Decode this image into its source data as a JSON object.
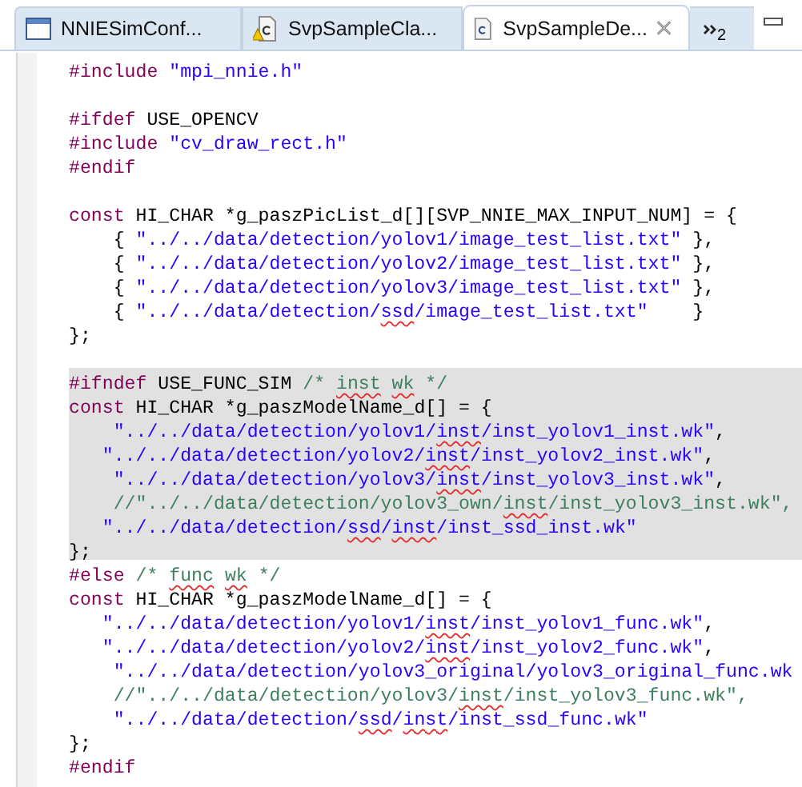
{
  "tabs": [
    {
      "label": "NNIESimConf...",
      "kind": "window",
      "selected": false
    },
    {
      "label": "SvpSampleCla...",
      "kind": "c_warning",
      "selected": false
    },
    {
      "label": "SvpSampleDe...",
      "kind": "c",
      "selected": true
    }
  ],
  "overflow": {
    "label": "2"
  },
  "lines": [
    {
      "kind": "code",
      "highlighted": false,
      "tokens": [
        {
          "t": "#include",
          "kind": "preproc",
          "misspelled": false
        },
        {
          "t": " \"mpi_nnie.h\"",
          "kind": "string",
          "misspelled": false
        }
      ]
    },
    {
      "kind": "blank",
      "highlighted": false
    },
    {
      "kind": "code",
      "highlighted": false,
      "tokens": [
        {
          "t": "#ifdef",
          "kind": "preproc",
          "misspelled": false
        },
        {
          "t": " USE_OPENCV",
          "kind": "plain",
          "misspelled": false
        }
      ]
    },
    {
      "kind": "code",
      "highlighted": false,
      "tokens": [
        {
          "t": "#include",
          "kind": "preproc",
          "misspelled": false
        },
        {
          "t": " \"cv_draw_rect.h\"",
          "kind": "string",
          "misspelled": false
        }
      ]
    },
    {
      "kind": "code",
      "highlighted": false,
      "tokens": [
        {
          "t": "#endif",
          "kind": "preproc",
          "misspelled": false
        }
      ]
    },
    {
      "kind": "blank",
      "highlighted": false
    },
    {
      "kind": "code",
      "highlighted": false,
      "tokens": [
        {
          "t": "const",
          "kind": "keyword",
          "misspelled": false
        },
        {
          "t": " HI_CHAR *g_paszPicList_d[][SVP_NNIE_MAX_INPUT_NUM] = {",
          "kind": "plain",
          "misspelled": false
        }
      ]
    },
    {
      "kind": "code",
      "highlighted": false,
      "tokens": [
        {
          "t": "    { ",
          "kind": "plain",
          "misspelled": false
        },
        {
          "t": "\"../../data/detection/yolov1/image_test_list.txt\"",
          "kind": "string",
          "misspelled": false
        },
        {
          "t": " },",
          "kind": "plain",
          "misspelled": false
        }
      ]
    },
    {
      "kind": "code",
      "highlighted": false,
      "tokens": [
        {
          "t": "    { ",
          "kind": "plain",
          "misspelled": false
        },
        {
          "t": "\"../../data/detection/yolov2/image_test_list.txt\"",
          "kind": "string",
          "misspelled": false
        },
        {
          "t": " },",
          "kind": "plain",
          "misspelled": false
        }
      ]
    },
    {
      "kind": "code",
      "highlighted": false,
      "tokens": [
        {
          "t": "    { ",
          "kind": "plain",
          "misspelled": false
        },
        {
          "t": "\"../../data/detection/yolov3/image_test_list.txt\"",
          "kind": "string",
          "misspelled": false
        },
        {
          "t": " },",
          "kind": "plain",
          "misspelled": false
        }
      ]
    },
    {
      "kind": "code",
      "highlighted": false,
      "tokens": [
        {
          "t": "    { ",
          "kind": "plain",
          "misspelled": false
        },
        {
          "t": "\"../../data/detection/",
          "kind": "string",
          "misspelled": false
        },
        {
          "t": "ssd",
          "kind": "string",
          "misspelled": true
        },
        {
          "t": "/image_test_list.txt\"",
          "kind": "string",
          "misspelled": false
        },
        {
          "t": "    }",
          "kind": "plain",
          "misspelled": false
        }
      ]
    },
    {
      "kind": "code",
      "highlighted": false,
      "tokens": [
        {
          "t": "};",
          "kind": "plain",
          "misspelled": false
        }
      ]
    },
    {
      "kind": "blank",
      "highlighted": false
    },
    {
      "kind": "code",
      "highlighted": true,
      "tokens": [
        {
          "t": "#ifndef",
          "kind": "preproc",
          "misspelled": false
        },
        {
          "t": " USE_FUNC_SIM ",
          "kind": "plain",
          "misspelled": false
        },
        {
          "t": "/* ",
          "kind": "comment",
          "misspelled": false
        },
        {
          "t": "inst",
          "kind": "comment",
          "misspelled": true
        },
        {
          "t": " wk",
          "kind": "comment",
          "misspelled": true
        },
        {
          "t": " */",
          "kind": "comment",
          "misspelled": false
        }
      ]
    },
    {
      "kind": "code",
      "highlighted": true,
      "tokens": [
        {
          "t": "const",
          "kind": "keyword",
          "misspelled": false
        },
        {
          "t": " HI_CHAR *g_paszModelName_d[] = {",
          "kind": "plain",
          "misspelled": false
        }
      ]
    },
    {
      "kind": "code",
      "highlighted": true,
      "tokens": [
        {
          "t": "    \"../../data/detection/yolov1/",
          "kind": "string",
          "misspelled": false
        },
        {
          "t": "inst",
          "kind": "string",
          "misspelled": true
        },
        {
          "t": "/inst_yolov1_inst.wk\"",
          "kind": "string",
          "misspelled": false
        },
        {
          "t": ",",
          "kind": "plain",
          "misspelled": false
        }
      ]
    },
    {
      "kind": "code",
      "highlighted": true,
      "tokens": [
        {
          "t": "   \"../../data/detection/yolov2/",
          "kind": "string",
          "misspelled": false
        },
        {
          "t": "inst",
          "kind": "string",
          "misspelled": true
        },
        {
          "t": "/inst_yolov2_inst.wk\"",
          "kind": "string",
          "misspelled": false
        },
        {
          "t": ",",
          "kind": "plain",
          "misspelled": false
        }
      ]
    },
    {
      "kind": "code",
      "highlighted": true,
      "tokens": [
        {
          "t": "    \"../../data/detection/yolov3/",
          "kind": "string",
          "misspelled": false
        },
        {
          "t": "inst",
          "kind": "string",
          "misspelled": true
        },
        {
          "t": "/inst_yolov3_inst.wk\"",
          "kind": "string",
          "misspelled": false
        },
        {
          "t": ",",
          "kind": "plain",
          "misspelled": false
        }
      ]
    },
    {
      "kind": "code",
      "highlighted": true,
      "tokens": [
        {
          "t": "    //\"../../data/detection/yolov3_own/",
          "kind": "comment",
          "misspelled": false
        },
        {
          "t": "inst",
          "kind": "comment",
          "misspelled": true
        },
        {
          "t": "/inst_yolov3_inst.wk\",",
          "kind": "comment",
          "misspelled": false
        }
      ]
    },
    {
      "kind": "code",
      "highlighted": true,
      "tokens": [
        {
          "t": "   \"../../data/detection/",
          "kind": "string",
          "misspelled": false
        },
        {
          "t": "ssd",
          "kind": "string",
          "misspelled": true
        },
        {
          "t": "/",
          "kind": "string",
          "misspelled": false
        },
        {
          "t": "inst",
          "kind": "string",
          "misspelled": true
        },
        {
          "t": "/inst_ssd_inst.wk\"",
          "kind": "string",
          "misspelled": false
        }
      ]
    },
    {
      "kind": "code",
      "highlighted": true,
      "tokens": [
        {
          "t": "};",
          "kind": "plain",
          "misspelled": false
        }
      ]
    },
    {
      "kind": "code",
      "highlighted": false,
      "tokens": [
        {
          "t": "#else",
          "kind": "preproc",
          "misspelled": false
        },
        {
          "t": " /* ",
          "kind": "comment",
          "misspelled": false
        },
        {
          "t": "func",
          "kind": "comment",
          "misspelled": true
        },
        {
          "t": " wk",
          "kind": "comment",
          "misspelled": true
        },
        {
          "t": " */",
          "kind": "comment",
          "misspelled": false
        }
      ]
    },
    {
      "kind": "code",
      "highlighted": false,
      "tokens": [
        {
          "t": "const",
          "kind": "keyword",
          "misspelled": false
        },
        {
          "t": " HI_CHAR *g_paszModelName_d[] = {",
          "kind": "plain",
          "misspelled": false
        }
      ]
    },
    {
      "kind": "code",
      "highlighted": false,
      "tokens": [
        {
          "t": "   \"../../data/detection/yolov1/",
          "kind": "string",
          "misspelled": false
        },
        {
          "t": "inst",
          "kind": "string",
          "misspelled": true
        },
        {
          "t": "/inst_yolov1_func.wk\"",
          "kind": "string",
          "misspelled": false
        },
        {
          "t": ",",
          "kind": "plain",
          "misspelled": false
        }
      ]
    },
    {
      "kind": "code",
      "highlighted": false,
      "tokens": [
        {
          "t": "   \"../../data/detection/yolov2/",
          "kind": "string",
          "misspelled": false
        },
        {
          "t": "inst",
          "kind": "string",
          "misspelled": true
        },
        {
          "t": "/inst_yolov2_func.wk\"",
          "kind": "string",
          "misspelled": false
        },
        {
          "t": ",",
          "kind": "plain",
          "misspelled": false
        }
      ]
    },
    {
      "kind": "code",
      "highlighted": false,
      "tokens": [
        {
          "t": "    \"../../data/detection/yolov3_original/yolov3_original_func.wk",
          "kind": "string",
          "misspelled": false
        }
      ]
    },
    {
      "kind": "code",
      "highlighted": false,
      "tokens": [
        {
          "t": "    //\"../../data/detection/yolov3/",
          "kind": "comment",
          "misspelled": false
        },
        {
          "t": "inst",
          "kind": "comment",
          "misspelled": true
        },
        {
          "t": "/inst_yolov3_func.wk\",",
          "kind": "comment",
          "misspelled": false
        }
      ]
    },
    {
      "kind": "code",
      "highlighted": false,
      "tokens": [
        {
          "t": "    \"../../data/detection/",
          "kind": "string",
          "misspelled": false
        },
        {
          "t": "ssd",
          "kind": "string",
          "misspelled": true
        },
        {
          "t": "/",
          "kind": "string",
          "misspelled": false
        },
        {
          "t": "inst",
          "kind": "string",
          "misspelled": true
        },
        {
          "t": "/inst_ssd_func.wk\"",
          "kind": "string",
          "misspelled": false
        }
      ]
    },
    {
      "kind": "code",
      "highlighted": false,
      "tokens": [
        {
          "t": "};",
          "kind": "plain",
          "misspelled": false
        }
      ]
    },
    {
      "kind": "code",
      "highlighted": false,
      "tokens": [
        {
          "t": "#endif",
          "kind": "preproc",
          "misspelled": false
        }
      ]
    }
  ]
}
